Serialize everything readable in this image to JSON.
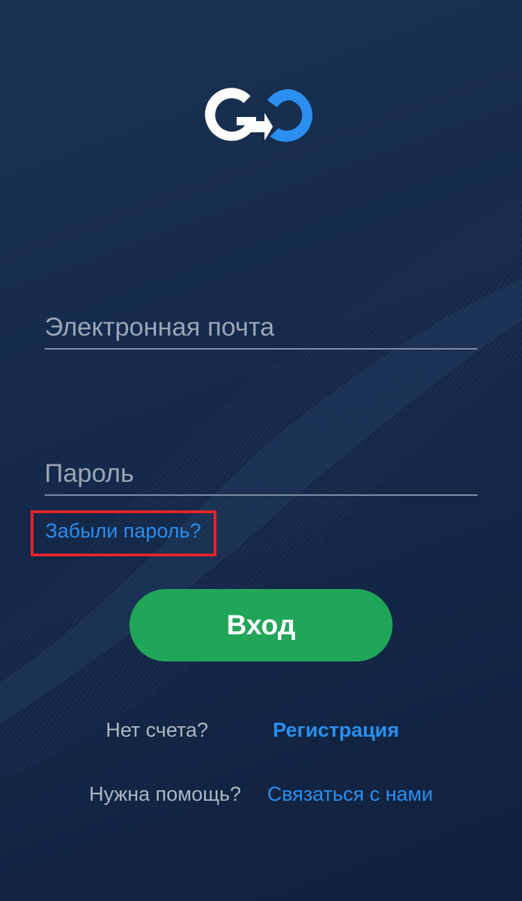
{
  "login": {
    "email_placeholder": "Электронная почта",
    "password_placeholder": "Пароль",
    "forgot_password": "Забыли пароль?",
    "login_button": "Вход"
  },
  "footer": {
    "no_account": "Нет счета?",
    "register": "Регистрация",
    "need_help": "Нужна помощь?",
    "contact_us": "Связаться с нами"
  },
  "colors": {
    "background": "#15294a",
    "accent_blue": "#2a8ff0",
    "button_green": "#21a659",
    "highlight_red": "#e8232a"
  },
  "icons": {
    "logo": "go-logo"
  }
}
